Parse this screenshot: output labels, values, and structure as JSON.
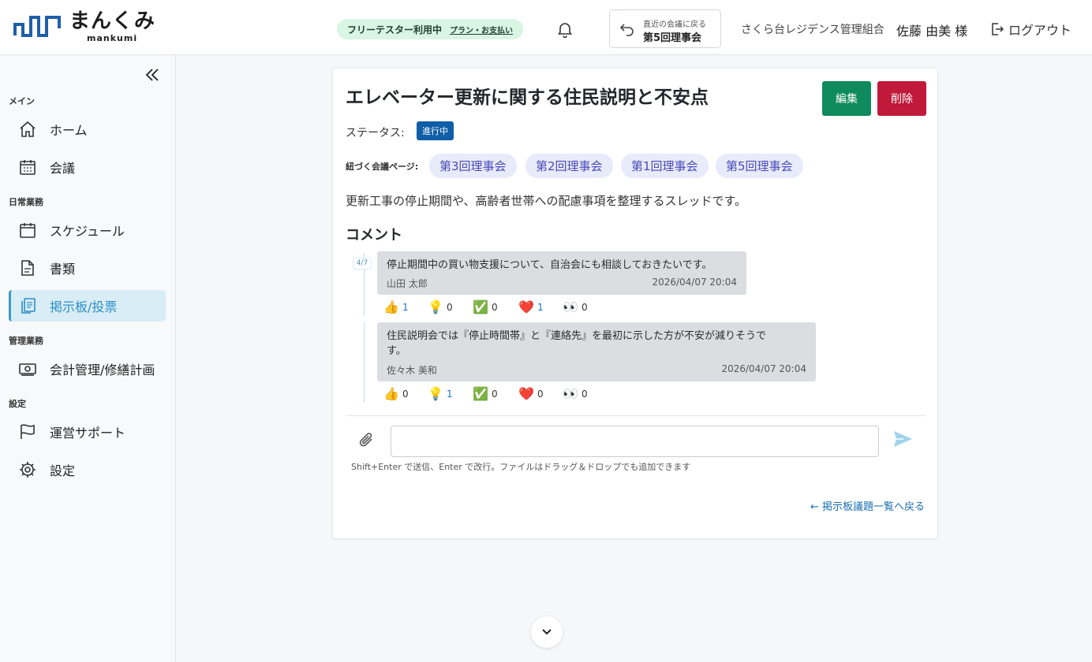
{
  "header": {
    "logo_text": "まんくみ",
    "logo_sub": "mankumi",
    "plan_badge": "フリーテスター利用中",
    "plan_link": "プラン・お支払い",
    "recent_small": "直近の会議に戻る",
    "recent_big": "第5回理事会",
    "org_name": "さくら台レジデンス管理組合",
    "user_name": "佐藤 由美 様",
    "logout_label": "ログアウト",
    "icons": [
      "bell-icon",
      "return-icon",
      "logout-icon",
      "collapse-icon"
    ]
  },
  "sidebar": {
    "sections": {
      "main": "メイン",
      "daily": "日常業務",
      "management": "管理業務",
      "settings": "設定"
    },
    "items": [
      {
        "label": "ホーム",
        "icon": "home-icon"
      },
      {
        "label": "会議",
        "icon": "calendar-grid-icon"
      },
      {
        "label": "スケジュール",
        "icon": "calendar-icon"
      },
      {
        "label": "書類",
        "icon": "document-icon"
      },
      {
        "label": "掲示板/投票",
        "icon": "clipboard-icon",
        "active": true
      },
      {
        "label": "会計管理/修繕計画",
        "icon": "money-icon"
      },
      {
        "label": "運営サポート",
        "icon": "flag-icon"
      },
      {
        "label": "設定",
        "icon": "gear-icon"
      }
    ]
  },
  "topic": {
    "title": "エレベーター更新に関する住民説明と不安点",
    "edit_label": "編集",
    "delete_label": "削除",
    "status_label": "ステータス:",
    "status_value": "進行中",
    "linked_label": "紐づく会議ページ:",
    "linked_pages": [
      "第3回理事会",
      "第2回理事会",
      "第1回理事会",
      "第5回理事会"
    ],
    "description": "更新工事の停止期間や、高齢者世帯への配慮事項を整理するスレッドです。"
  },
  "comments": {
    "heading": "コメント",
    "date_badge": "4/7",
    "items": [
      {
        "text": "停止期間中の買い物支援について、自治会にも相談しておきたいです。",
        "author": "山田 太郎",
        "time": "2026/04/07 20:04",
        "reactions": [
          {
            "emoji": "👍",
            "count": "1",
            "active": true
          },
          {
            "emoji": "💡",
            "count": "0"
          },
          {
            "emoji": "✅",
            "count": "0"
          },
          {
            "emoji": "❤️",
            "count": "1",
            "active": true
          },
          {
            "emoji": "👀",
            "count": "0"
          }
        ]
      },
      {
        "text_line1": "住民説明会では『停止時間帯』と『連絡先』を最初に示した方が不安が減りそうで",
        "text_line2": "す。",
        "author": "佐々木 美和",
        "time": "2026/04/07 20:04",
        "reactions": [
          {
            "emoji": "👍",
            "count": "0"
          },
          {
            "emoji": "💡",
            "count": "1",
            "active": true
          },
          {
            "emoji": "✅",
            "count": "0"
          },
          {
            "emoji": "❤️",
            "count": "0"
          },
          {
            "emoji": "👀",
            "count": "0"
          }
        ]
      }
    ]
  },
  "composer": {
    "input_value": "",
    "hint": "Shift+Enter で送信、Enter で改行。ファイルはドラッグ＆ドロップでも追加できます",
    "back_link": "← 掲示板議題一覧へ戻る"
  },
  "colors": {
    "accent": "#3a9bc6",
    "edit": "#0f8a5f",
    "delete": "#c0193a",
    "status": "#0f5ea8",
    "chip_bg": "#e7ebfa",
    "chip_text": "#4a48b8"
  }
}
